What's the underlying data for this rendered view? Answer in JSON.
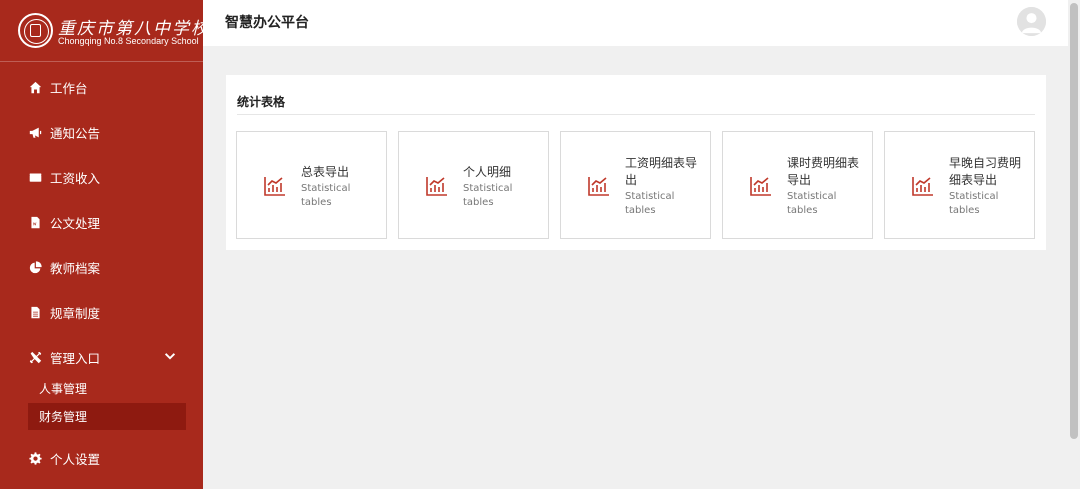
{
  "sidebar": {
    "logo_cn": "重庆市第八中学校",
    "logo_en": "Chongqing No.8 Secondary School",
    "items": [
      {
        "label": "工作台"
      },
      {
        "label": "通知公告"
      },
      {
        "label": "工资收入"
      },
      {
        "label": "公文处理"
      },
      {
        "label": "教师档案"
      },
      {
        "label": "规章制度"
      },
      {
        "label": "管理入口"
      },
      {
        "label": "个人设置"
      }
    ],
    "subitems": [
      {
        "label": "人事管理"
      },
      {
        "label": "财务管理"
      }
    ],
    "active_subitem": "财务管理",
    "colors": {
      "background": "#a8291c",
      "active": "#8e1a10"
    }
  },
  "header": {
    "title": "智慧办公平台"
  },
  "panel": {
    "title": "统计表格",
    "cards": [
      {
        "title": "总表导出",
        "sub": "Statistical tables"
      },
      {
        "title": "个人明细",
        "sub": "Statistical tables"
      },
      {
        "title": "工资明细表导出",
        "sub": "Statistical tables"
      },
      {
        "title": "课时费明细表导出",
        "sub": "Statistical tables"
      },
      {
        "title": "早晚自习费明细表导出",
        "sub": "Statistical tables"
      }
    ],
    "icon_color": "#c0392b"
  }
}
